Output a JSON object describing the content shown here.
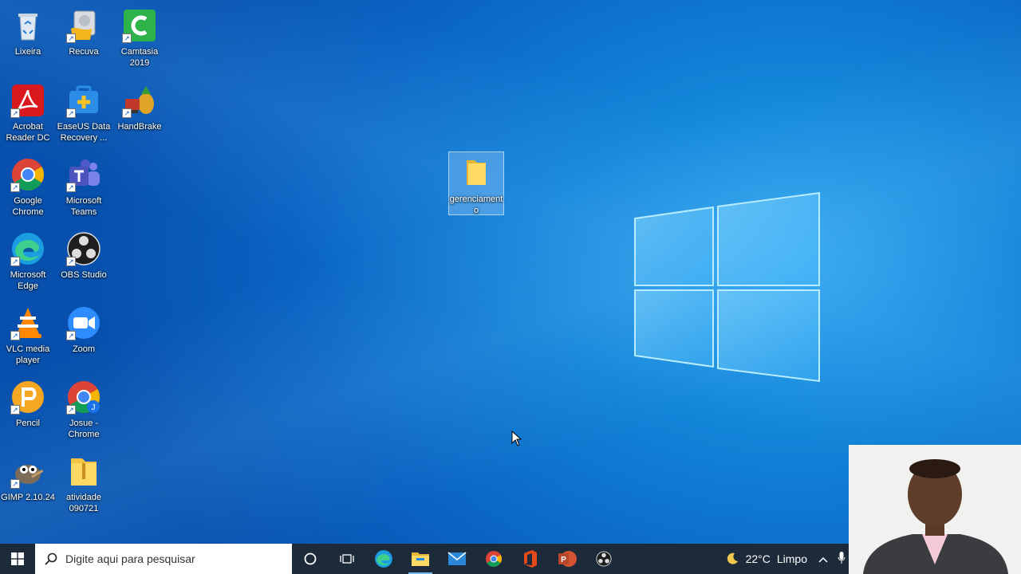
{
  "desktop_icons": [
    {
      "label": "Lixeira"
    },
    {
      "label": "Recuva"
    },
    {
      "label": "Camtasia 2019"
    },
    {
      "label": "Acrobat Reader DC"
    },
    {
      "label": "EaseUS Data Recovery ..."
    },
    {
      "label": "HandBrake"
    },
    {
      "label": "Google Chrome"
    },
    {
      "label": "Microsoft Teams"
    },
    {
      "label": "Microsoft Edge"
    },
    {
      "label": "OBS Studio"
    },
    {
      "label": "VLC media player"
    },
    {
      "label": "Zoom"
    },
    {
      "label": "Pencil"
    },
    {
      "label": "Josue - Chrome"
    },
    {
      "label": "GIMP 2.10.24"
    },
    {
      "label": "atividade 090721"
    }
  ],
  "selected_folder": {
    "label": "gerenciamento"
  },
  "taskbar": {
    "search_placeholder": "Digite aqui para pesquisar",
    "apps": [
      "cortana-icon",
      "task-view-icon",
      "edge-icon",
      "file-explorer-icon",
      "mail-icon",
      "chrome-icon",
      "office-icon",
      "powerpoint-icon",
      "obs-icon"
    ],
    "weather": {
      "temp": "22°C",
      "condition": "Limpo"
    }
  },
  "colors": {
    "desktop": "#0a63c2",
    "taskbar": "#1c2a3a",
    "accent": "#76b9ed"
  }
}
